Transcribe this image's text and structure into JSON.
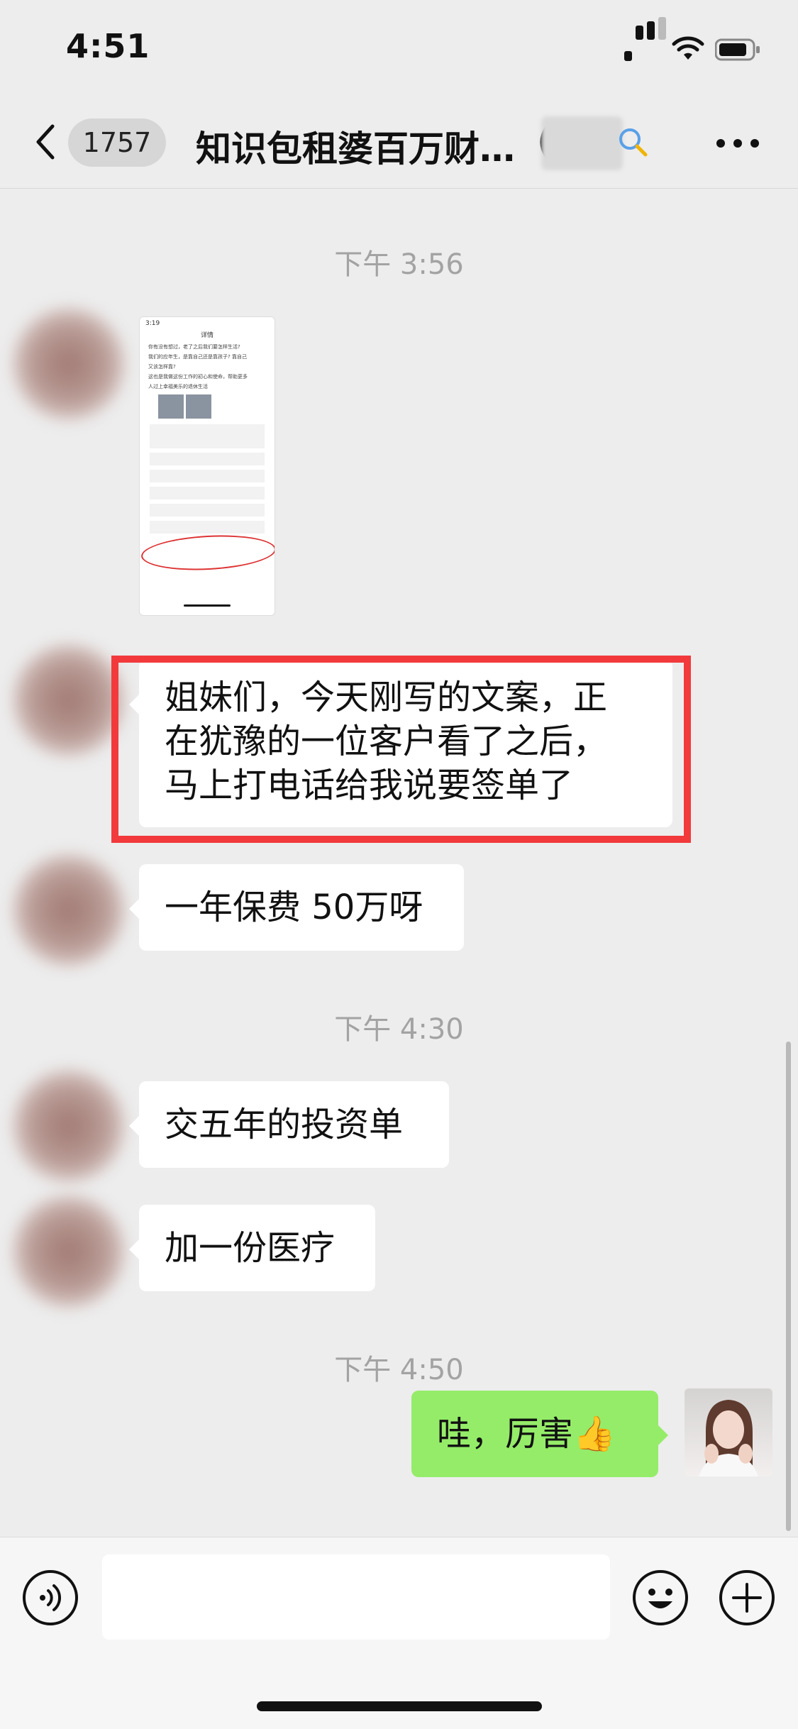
{
  "status_bar": {
    "time": "4:51"
  },
  "nav": {
    "unread_count": "1757",
    "title": "知识包租婆百万财…",
    "paren": "("
  },
  "messages": [
    {
      "type": "timestamp",
      "text": "下午 3:56"
    },
    {
      "type": "image",
      "sender": "other"
    },
    {
      "type": "text",
      "sender": "other",
      "lines": [
        "姐妹们，今天刚写的文案，正",
        "在犹豫的一位客户看了之后，",
        "马上打电话给我说要签单了"
      ]
    },
    {
      "type": "text",
      "sender": "other",
      "text": "一年保费 50万呀"
    },
    {
      "type": "timestamp",
      "text": "下午 4:30"
    },
    {
      "type": "text",
      "sender": "other",
      "text": "交五年的投资单"
    },
    {
      "type": "text",
      "sender": "other",
      "text": "加一份医疗"
    },
    {
      "type": "timestamp",
      "text": "下午 4:50"
    },
    {
      "type": "text",
      "sender": "me",
      "text": "哇，厉害👍"
    }
  ],
  "thumbnail": {
    "header": "详情",
    "time": "3:19",
    "lines": [
      "你有没有想过，老了之后我们要怎样生活?",
      "我们的应年生，是靠自己还是靠孩子? 靠自己",
      "又该怎样靠?",
      "这也是我做这份工作的初心和使命，帮助更多",
      "人过上幸福美乐的退休生活"
    ]
  },
  "colors": {
    "bubble_me": "#95ec69",
    "highlight_border": "#f23a3c",
    "background": "#ededed"
  }
}
